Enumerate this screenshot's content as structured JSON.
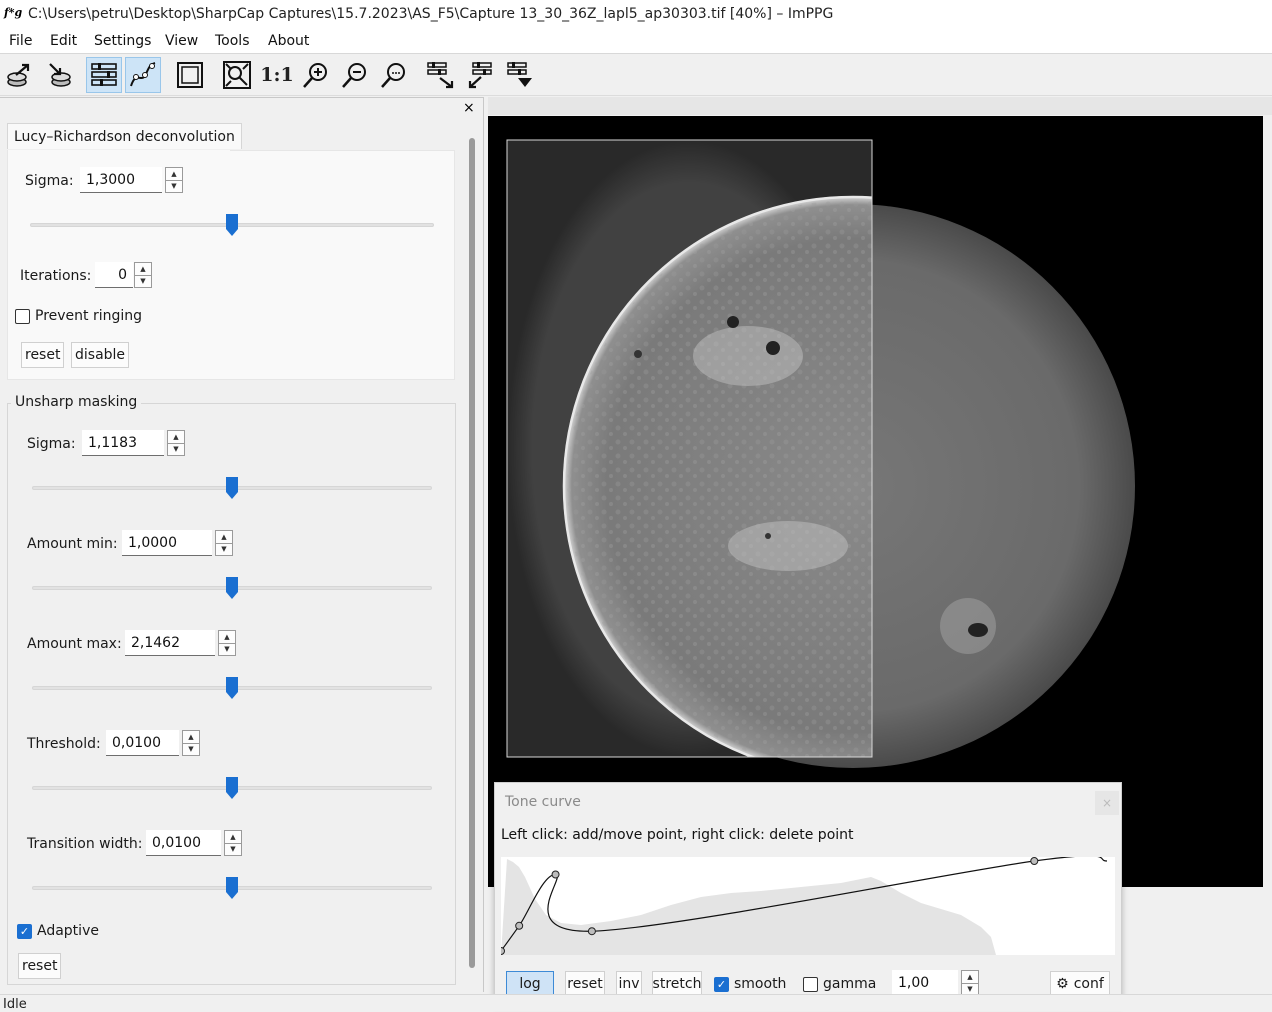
{
  "window": {
    "title": "C:\\Users\\petru\\Desktop\\SharpCap Captures\\15.7.2023\\AS_F5\\Capture 13_30_36Z_lapl5_ap30303.tif [40%] – ImPPG",
    "app_icon_text": "f*g"
  },
  "menu": {
    "items": [
      "File",
      "Edit",
      "Settings",
      "View",
      "Tools",
      "About"
    ]
  },
  "toolbar": {
    "buttons": [
      {
        "icon": "open-file-icon",
        "active": false
      },
      {
        "icon": "save-file-icon",
        "active": false
      },
      {
        "icon": "processing-settings-icon",
        "active": true
      },
      {
        "icon": "tone-curve-icon",
        "active": true
      },
      {
        "icon": "select-all-icon",
        "active": false
      },
      {
        "icon": "zoom-fit-icon",
        "active": false
      },
      {
        "icon": "zoom-actual-icon",
        "label": "1:1",
        "active": false
      },
      {
        "icon": "zoom-in-icon",
        "active": false
      },
      {
        "icon": "zoom-out-icon",
        "active": false
      },
      {
        "icon": "zoom-custom-icon",
        "active": false
      },
      {
        "icon": "batch-align-icon",
        "active": false
      },
      {
        "icon": "batch-process-icon",
        "active": false
      },
      {
        "icon": "batch-export-icon",
        "active": false
      }
    ]
  },
  "panel": {
    "close_label": "×",
    "lucy": {
      "title": "Lucy–Richardson deconvolution",
      "sigma_label": "Sigma:",
      "sigma_value": "1,3000",
      "sigma_slider": 0.5,
      "iterations_label": "Iterations:",
      "iterations_value": "0",
      "prevent_ringing_label": "Prevent ringing",
      "prevent_ringing_checked": false,
      "reset_label": "reset",
      "disable_label": "disable"
    },
    "unsharp": {
      "title": "Unsharp masking",
      "sigma_label": "Sigma:",
      "sigma_value": "1,1183",
      "sigma_slider": 0.5,
      "amount_min_label": "Amount min:",
      "amount_min_value": "1,0000",
      "amount_min_slider": 0.5,
      "amount_max_label": "Amount max:",
      "amount_max_value": "2,1462",
      "amount_max_slider": 0.5,
      "threshold_label": "Threshold:",
      "threshold_value": "0,0100",
      "threshold_slider": 0.5,
      "transition_label": "Transition width:",
      "transition_value": "0,0100",
      "transition_slider": 0.5,
      "adaptive_label": "Adaptive",
      "adaptive_checked": true,
      "reset_label": "reset"
    }
  },
  "tone_curve": {
    "title": "Tone curve",
    "close_label": "×",
    "hint": "Left click: add/move point, right click: delete point",
    "buttons": {
      "log": "log",
      "reset": "reset",
      "inv": "inv",
      "stretch": "stretch",
      "conf": "conf"
    },
    "log_pressed": true,
    "smooth_label": "smooth",
    "smooth_checked": true,
    "gamma_label": "gamma",
    "gamma_checked": false,
    "gamma_value": "1,00",
    "points": [
      [
        0.0,
        0.0
      ],
      [
        0.03,
        0.28
      ],
      [
        0.09,
        0.85
      ],
      [
        0.15,
        0.22
      ],
      [
        0.88,
        1.0
      ],
      [
        1.0,
        1.0
      ]
    ]
  },
  "status": {
    "text": "Idle"
  },
  "colors": {
    "accent": "#1a6fd1",
    "slider_thumb": "#1a6fd1",
    "pressed_bg": "#cfe3f6"
  }
}
